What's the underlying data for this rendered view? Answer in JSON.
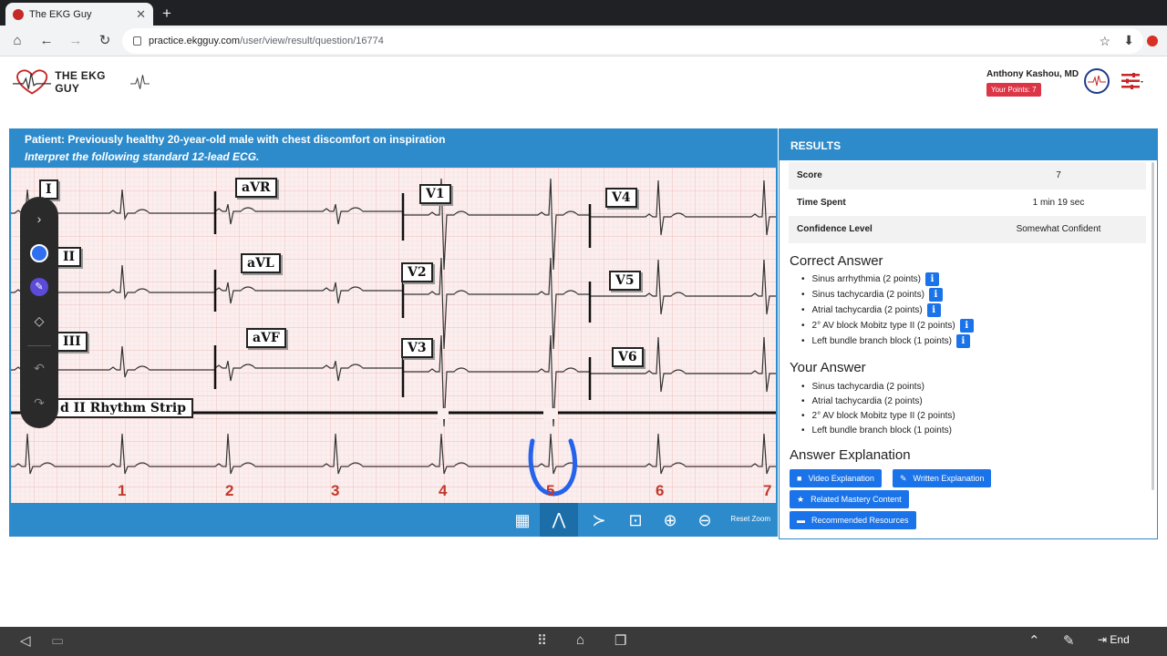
{
  "browser": {
    "tab_title": "The EKG Guy",
    "url_host": "practice.ekgguy.com",
    "url_path": "/user/view/result/question/16774"
  },
  "site": {
    "logo_text": "THE EKG GUY",
    "user_name": "Anthony Kashou, MD",
    "points_label": "Your Points: 7"
  },
  "question": {
    "patient": "Patient: Previously healthy 20-year-old male with chest discomfort on inspiration",
    "instruction": "Interpret the following standard 12-lead ECG.",
    "leads": [
      "I",
      "aVR",
      "V1",
      "V4",
      "II",
      "aVL",
      "V2",
      "V5",
      "III",
      "aVF",
      "V3",
      "V6"
    ],
    "rhythm_strip_label": "d II Rhythm Strip",
    "seconds": [
      "1",
      "2",
      "3",
      "4",
      "5",
      "6",
      "7"
    ],
    "reset_zoom": "Reset Zoom"
  },
  "results": {
    "header": "RESULTS",
    "rows": [
      {
        "key": "Score",
        "value": "7"
      },
      {
        "key": "Time Spent",
        "value": "1 min 19 sec"
      },
      {
        "key": "Confidence Level",
        "value": "Somewhat Confident"
      }
    ],
    "correct_title": "Correct Answer",
    "correct": [
      "Sinus arrhythmia (2 points)",
      "Sinus tachycardia (2 points)",
      "Atrial tachycardia (2 points)",
      "2° AV block Mobitz type II (2 points)",
      "Left bundle branch block (1 points)"
    ],
    "your_title": "Your Answer",
    "your": [
      "Sinus tachycardia (2 points)",
      "Atrial tachycardia (2 points)",
      "2° AV block Mobitz type II (2 points)",
      "Left bundle branch block (1 points)"
    ],
    "explanation_title": "Answer Explanation",
    "buttons": {
      "video": "Video Explanation",
      "written": "Written Explanation",
      "mastery": "Related Mastery Content",
      "resources": "Recommended Resources"
    }
  },
  "system": {
    "end_label": "End"
  },
  "colors": {
    "brand_blue": "#2e8bcb",
    "button_blue": "#1a73e8",
    "points_red": "#dc3545",
    "ecg_grid": "#f3c6c6"
  }
}
